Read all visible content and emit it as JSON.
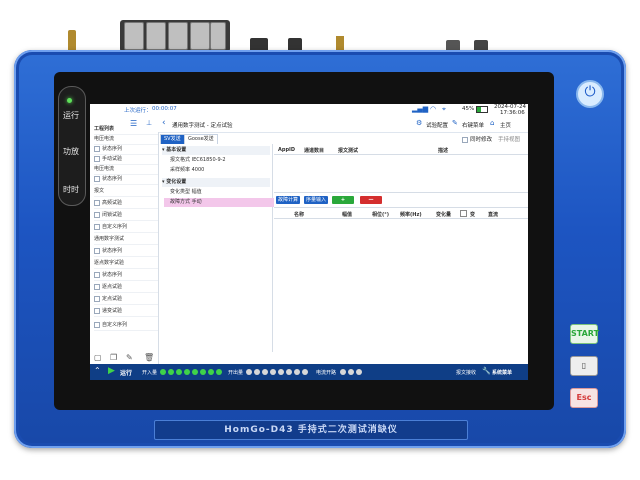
{
  "hardware": {
    "left_buttons": [
      "运行",
      "功放",
      "时时"
    ],
    "right_buttons": {
      "start": "START",
      "esc": "Esc"
    },
    "nameplate": "HomGo-D43   手持式二次测试消缺仪"
  },
  "screen": {
    "last_run_label": "上次运行：",
    "last_run_value": "00:00:07",
    "battery": "45%",
    "date": "2024-07-24",
    "time": "17:36:06",
    "breadcrumb": "通用数字测试 - 定点试验",
    "nav_buttons": [
      "试验配置",
      "右键菜单",
      "主页"
    ],
    "edit_checkbox_label": "同时修改",
    "edit_checkbox_extra": "手持视图",
    "sidebar_header": "工程列表",
    "sidebar_items": [
      "工程列表",
      "电压电流",
      "状态序列",
      "手动试验",
      "电压电流",
      "状态序列",
      "报文",
      "高频试验",
      "闭锁试验",
      "自定义序列",
      "通用数字测试",
      "状态序列",
      "逐点数字试验",
      "状态序列",
      "逐点试验",
      "定点试验",
      "递变试验",
      "自定义序列"
    ],
    "tabs": [
      "SV发送",
      "Goose发送"
    ],
    "tree": {
      "basic_header": "基本设置",
      "message_format_label": "报文格式",
      "message_format_value": "IEC61850-9-2",
      "sample_rate_label": "采样频率",
      "sample_rate_value": "4000",
      "change_header": "变化设置",
      "change_type_label": "变化类型",
      "change_type_value": "幅值",
      "change_mode_label": "故障方式",
      "change_mode_value": "手动"
    },
    "table1_headers": [
      "AppID",
      "通道数目",
      "报文测试",
      "描述"
    ],
    "action_buttons": [
      "故障计算",
      "序量输入",
      "+",
      "—"
    ],
    "table2_headers": [
      "名称",
      "幅值",
      "相位(°)",
      "频率(Hz)",
      "变化量",
      "变",
      "直流"
    ],
    "status": {
      "run_label": "运行",
      "input_label": "开入量",
      "output_label": "开出量",
      "current_label": "电流开路",
      "message_label": "报文接收",
      "system_menu": "系统菜单"
    }
  }
}
